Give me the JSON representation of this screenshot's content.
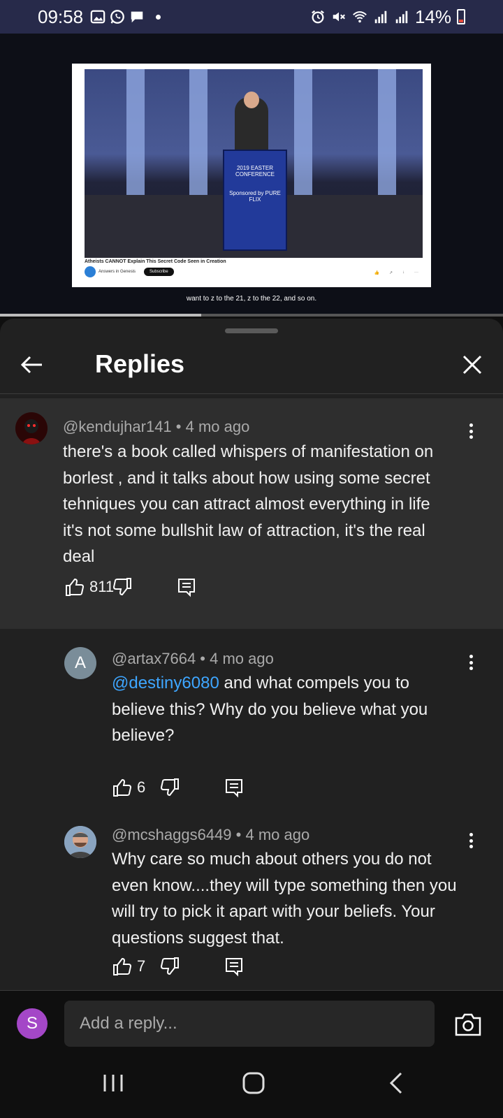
{
  "status_bar": {
    "time": "09:58",
    "battery": "14%",
    "left_icons": [
      "gallery-icon",
      "whatsapp-icon",
      "chat-icon"
    ],
    "right_icons": [
      "alarm-icon",
      "mute-icon",
      "wifi-icon",
      "signal-icon",
      "signal-icon",
      "battery-icon"
    ]
  },
  "video": {
    "title": "Atheists CANNOT Explain This Secret Code Seen in Creation",
    "channel": "Answers in Genesis",
    "subscribe_label": "Subscribe",
    "podium_text": "2019 EASTER CONFERENCE",
    "podium_sponsor": "Sponsored by PURE FLIX",
    "caption": "want to z to the 21, z to the 22, and so on.",
    "progress": 0.4
  },
  "panel": {
    "title": "Replies"
  },
  "comments": [
    {
      "author": "@kendujhar141",
      "age": "4 mo ago",
      "meta": "@kendujhar141 • 4 mo ago",
      "text": "there's a book called whispers of manifestation on borlest , and it talks about how using some secret tehniques you can attract almost everything in life  it's not some bullshit law of attraction, it's the real deal",
      "likes": "811"
    },
    {
      "author": "@artax7664",
      "age": "4 mo ago",
      "meta": "@artax7664 • 4 mo ago",
      "avatar_letter": "A",
      "mention": "@destiny6080",
      "text": " and what compels you to believe this? Why do you believe what you believe?",
      "likes": "6"
    },
    {
      "author": "@mcshaggs6449",
      "age": "4 mo ago",
      "meta": "@mcshaggs6449 • 4 mo ago",
      "text": "Why care so much about others you do not even know....they will type something then you will try to pick it apart with your beliefs. Your questions suggest that.",
      "likes": "7"
    }
  ],
  "reply_bar": {
    "user_initial": "S",
    "placeholder": "Add a reply..."
  },
  "colors": {
    "status_bar_bg": "#272a4a",
    "panel_bg": "#212121",
    "highlight_bg": "#2e2e2e",
    "mention": "#3ea6ff",
    "user_avatar": "#a447c7"
  }
}
